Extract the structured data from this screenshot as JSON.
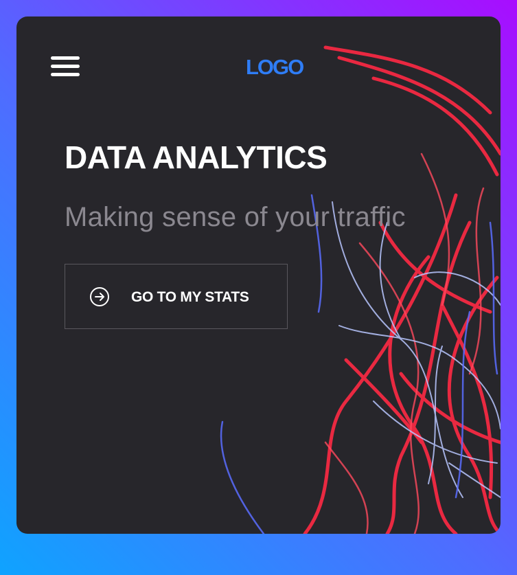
{
  "header": {
    "menu_icon": "hamburger-menu-icon",
    "logo_text": "LOGO"
  },
  "hero": {
    "title": "DATA ANALYTICS",
    "subtitle": "Making sense of your traffic",
    "cta_label": "GO TO MY STATS",
    "cta_icon": "arrow-right-circle-icon"
  },
  "colors": {
    "page_gradient_start": "#0fa3ff",
    "page_gradient_end": "#a80dff",
    "card_background": "#27262b",
    "logo": "#2f7df6",
    "light_red": "#ff2a44",
    "light_blue": "#8fa8ff"
  }
}
